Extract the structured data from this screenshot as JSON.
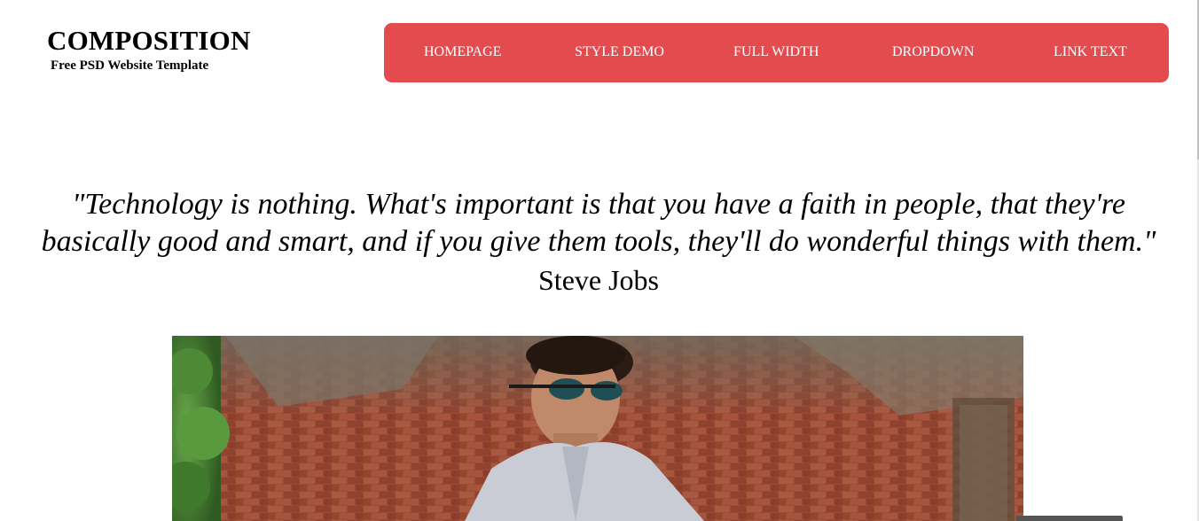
{
  "header": {
    "logo_title": "COMPOSITION",
    "logo_subtitle": "Free PSD Website Template"
  },
  "nav": {
    "background_color": "#e34b4f",
    "items": [
      {
        "label": "HOMEPAGE"
      },
      {
        "label": "STYLE DEMO"
      },
      {
        "label": "FULL WIDTH"
      },
      {
        "label": "DROPDOWN"
      },
      {
        "label": "LINK TEXT"
      }
    ]
  },
  "quote": {
    "text": "\"Technology is nothing. What's important is that you have a faith in people, that they're basically good and smart, and if you give them tools, they'll do wonderful things with them.\"",
    "author": "Steve Jobs"
  },
  "hero": {
    "image_icon": "hero-photo"
  }
}
